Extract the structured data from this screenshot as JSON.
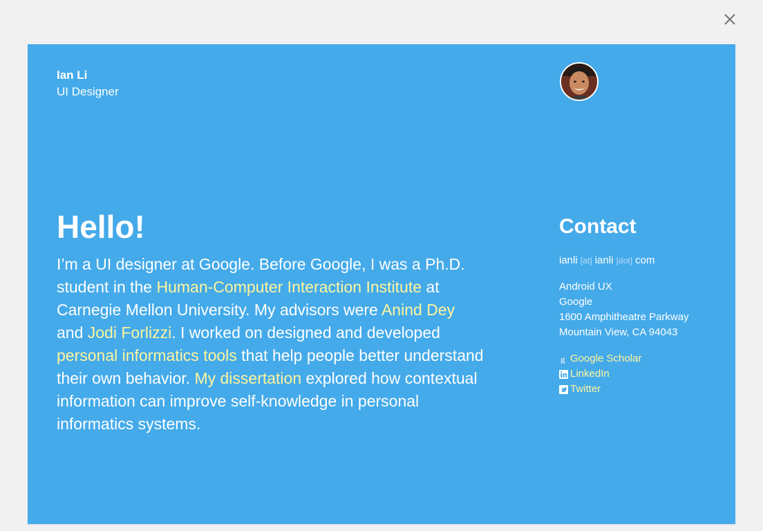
{
  "header": {
    "close_label": "close-icon"
  },
  "profile": {
    "name": "Ian Li",
    "role": "UI Designer"
  },
  "intro": {
    "heading": "Hello!",
    "segments": [
      {
        "text": "I’m a UI designer at Google. Before Google, I was a Ph.D. student in the ",
        "link": false
      },
      {
        "text": "Human-Computer Interaction Institute",
        "link": true
      },
      {
        "text": " at Carnegie Mellon University. My advisors were ",
        "link": false
      },
      {
        "text": "Anind Dey",
        "link": true
      },
      {
        "text": " and ",
        "link": false
      },
      {
        "text": "Jodi Forlizzi",
        "link": true
      },
      {
        "text": ". I worked on designed and developed ",
        "link": false
      },
      {
        "text": "personal informatics tools",
        "link": true
      },
      {
        "text": " that help people better understand their own behavior. ",
        "link": false
      },
      {
        "text": "My dissertation",
        "link": true
      },
      {
        "text": " explored how contextual information can improve self-knowledge in personal informatics systems.",
        "link": false
      }
    ]
  },
  "contact": {
    "title": "Contact",
    "email": {
      "user": "ianli",
      "at": "[at]",
      "domain": "ianli",
      "dot": "[dot]",
      "tld": "com"
    },
    "address": {
      "line1": "Android UX",
      "line2": "Google",
      "line3": "1600 Amphitheatre Parkway",
      "line4": "Mountain View, CA 94043"
    },
    "links": {
      "scholar": "Google Scholar",
      "linkedin": "LinkedIn",
      "twitter": "Twitter"
    }
  },
  "colors": {
    "card_bg": "#44aaea",
    "page_bg": "#f1f1f1",
    "link": "#fff59d",
    "text": "#ffffff"
  }
}
